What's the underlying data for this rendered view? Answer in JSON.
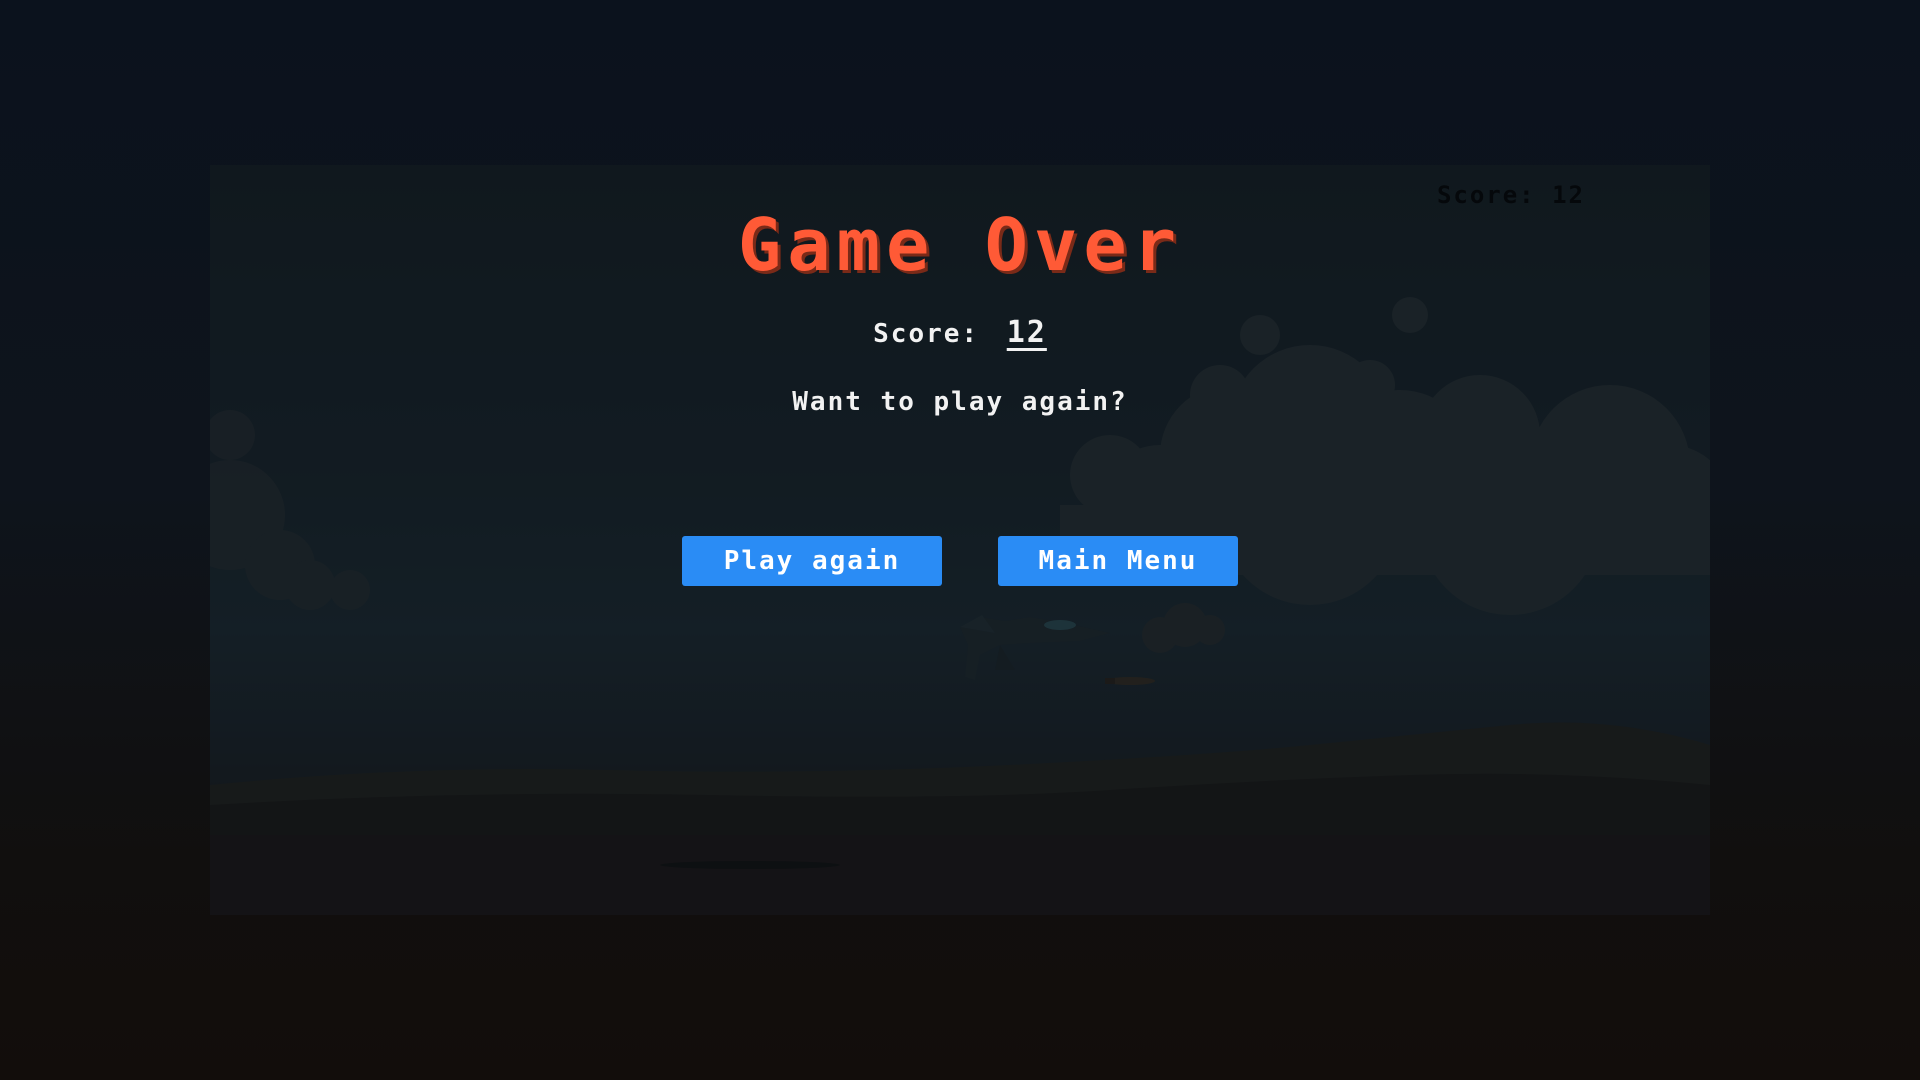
{
  "hud": {
    "score_label": "Score:",
    "score_value": "12"
  },
  "game_over": {
    "title": "Game Over",
    "score_label": "Score:",
    "score_value": "12",
    "prompt": "Want to play again?",
    "play_again_label": "Play again",
    "main_menu_label": "Main Menu"
  },
  "colors": {
    "title": "#ff5a36",
    "button": "#2a8cf5",
    "text": "#f2f2f2"
  },
  "icons": [
    "fighter-jet-sprite",
    "missile-sprite"
  ]
}
